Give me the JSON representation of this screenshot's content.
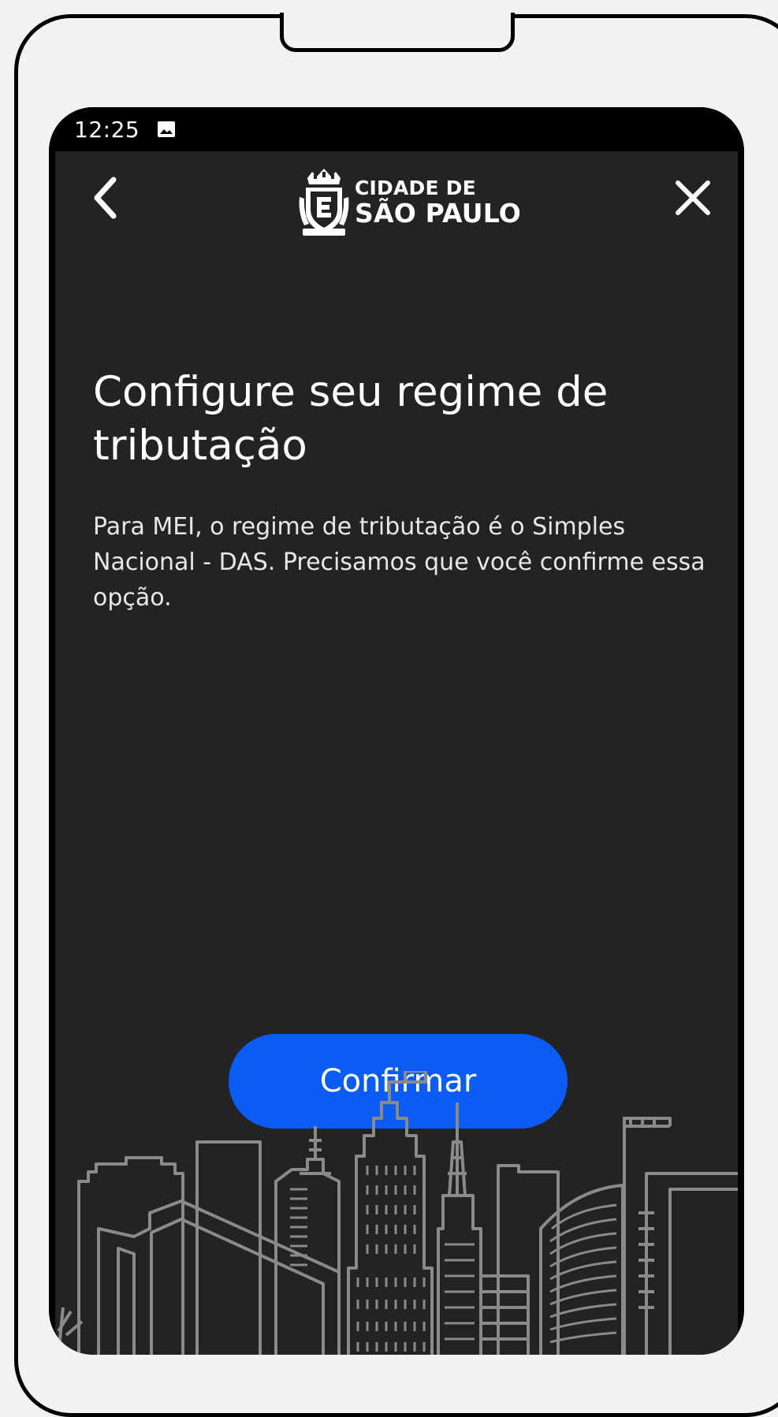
{
  "status_bar": {
    "time": "12:25",
    "notification_icon": "image-icon"
  },
  "header": {
    "back_icon": "chevron-left-icon",
    "close_icon": "close-icon",
    "logo": {
      "line1": "CIDADE DE",
      "line2": "SÃO PAULO"
    }
  },
  "main": {
    "title": "Configure seu regime de tributação",
    "description": "Para MEI, o regime de tributação é o Simples Nacional - DAS. Precisamos que você confirme essa opção.",
    "confirm_label": "Confirmar"
  },
  "colors": {
    "background": "#232323",
    "primary_button": "#0a5cf5",
    "skyline_stroke": "#8a8a8a"
  }
}
